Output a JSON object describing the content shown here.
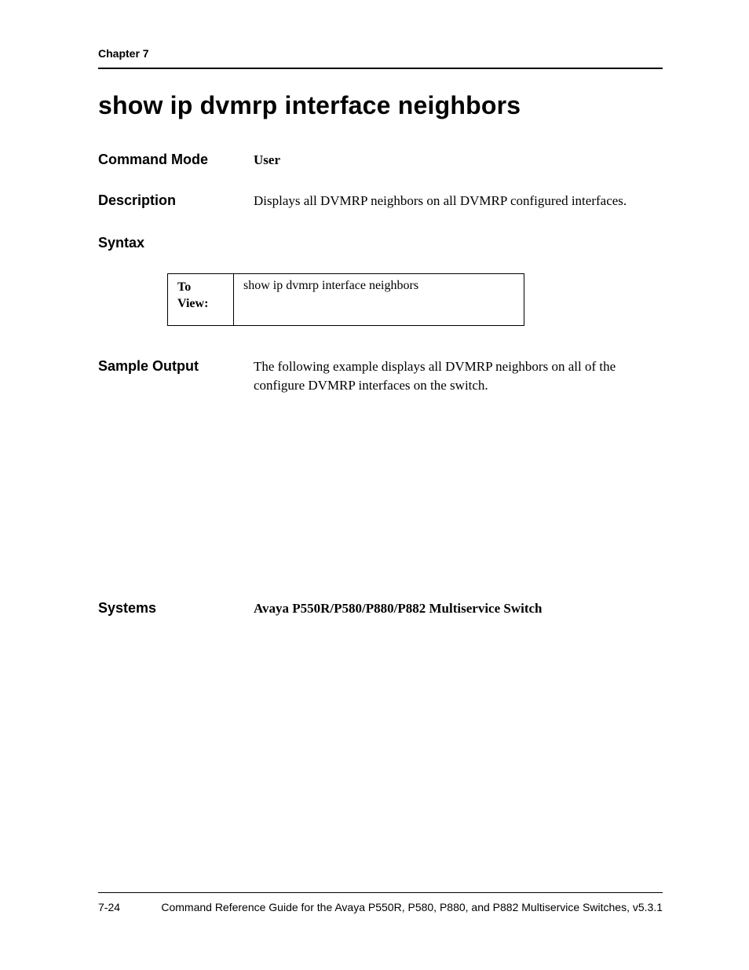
{
  "header": {
    "chapter": "Chapter 7"
  },
  "title": "show ip dvmrp interface neighbors",
  "commandMode": {
    "label": "Command Mode",
    "value": "User"
  },
  "description": {
    "label": "Description",
    "value": "Displays all DVMRP neighbors on all DVMRP configured interfaces."
  },
  "syntax": {
    "label": "Syntax",
    "table": {
      "leftLine1": "To",
      "leftLine2": "View:",
      "right": "show ip dvmrp interface neighbors"
    }
  },
  "sampleOutput": {
    "label": "Sample Output",
    "value": "The following example displays all DVMRP neighbors on all of the configure DVMRP interfaces on the switch."
  },
  "systems": {
    "label": "Systems",
    "value": "Avaya P550R/P580/P880/P882 Multiservice Switch"
  },
  "footer": {
    "pageNum": "7-24",
    "text": "Command Reference Guide for the Avaya P550R, P580, P880, and P882 Multiservice Switches, v5.3.1"
  }
}
